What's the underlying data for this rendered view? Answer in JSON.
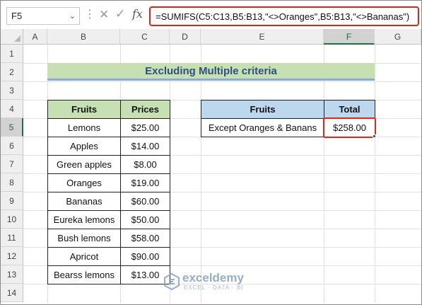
{
  "formula_bar": {
    "name_box": "F5",
    "formula": "=SUMIFS(C5:C13,B5:B13,\"<>Oranges\",B5:B13,\"<>Bananas\")",
    "fx_label": "fx"
  },
  "columns": [
    "A",
    "B",
    "C",
    "D",
    "E",
    "F",
    "G"
  ],
  "rows": [
    "1",
    "2",
    "3",
    "4",
    "5",
    "6",
    "7",
    "8",
    "9",
    "10",
    "11",
    "12",
    "13",
    "14"
  ],
  "title": "Excluding Multiple criteria",
  "fruits_table": {
    "headers": [
      "Fruits",
      "Prices"
    ],
    "rows": [
      [
        "Lemons",
        "$25.00"
      ],
      [
        "Apples",
        "$14.00"
      ],
      [
        "Green apples",
        "$8.00"
      ],
      [
        "Oranges",
        "$19.00"
      ],
      [
        "Bananas",
        "$60.00"
      ],
      [
        "Eureka lemons",
        "$50.00"
      ],
      [
        "Bush lemons",
        "$58.00"
      ],
      [
        "Apricot",
        "$90.00"
      ],
      [
        "Bearss lemons",
        "$13.00"
      ]
    ]
  },
  "result_table": {
    "headers": [
      "Fruits",
      "Total"
    ],
    "row": [
      "Except Oranges & Banans",
      "$258.00"
    ]
  },
  "watermark": {
    "name": "exceldemy",
    "tagline": "EXCEL · DATA · BI"
  },
  "colors": {
    "header_green": "#c6e0b4",
    "header_blue": "#bdd7ee",
    "highlight_red": "#e2231a",
    "excel_green": "#217346"
  }
}
